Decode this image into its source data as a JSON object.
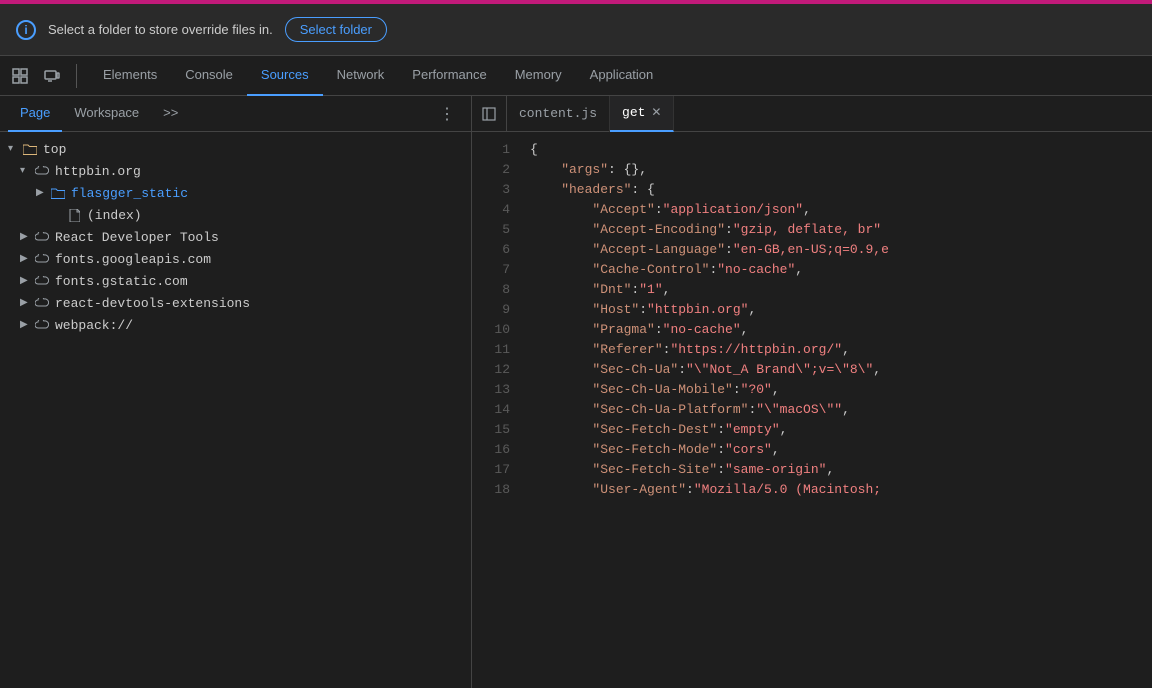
{
  "accent_bar": {
    "color": "#c21a7a"
  },
  "top_bar": {
    "info_text": "Select a folder to store override files in.",
    "select_folder_label": "Select folder"
  },
  "devtools_tabs": {
    "items": [
      {
        "label": "Elements",
        "active": false
      },
      {
        "label": "Console",
        "active": false
      },
      {
        "label": "Sources",
        "active": true
      },
      {
        "label": "Network",
        "active": false
      },
      {
        "label": "Performance",
        "active": false
      },
      {
        "label": "Memory",
        "active": false
      },
      {
        "label": "Application",
        "active": false
      }
    ]
  },
  "sub_tabs": {
    "items": [
      {
        "label": "Page",
        "active": true
      },
      {
        "label": "Workspace",
        "active": false
      },
      {
        "label": ">>",
        "active": false
      }
    ]
  },
  "file_tree": {
    "items": [
      {
        "label": "top",
        "type": "folder",
        "indent": 0,
        "expanded": true,
        "arrow": "▾"
      },
      {
        "label": "httpbin.org",
        "type": "cloud",
        "indent": 1,
        "expanded": true,
        "arrow": "▾"
      },
      {
        "label": "flasgger_static",
        "type": "folder",
        "indent": 2,
        "expanded": false,
        "arrow": "▶"
      },
      {
        "label": "(index)",
        "type": "file",
        "indent": 3,
        "expanded": false,
        "arrow": ""
      },
      {
        "label": "React Developer Tools",
        "type": "cloud",
        "indent": 1,
        "expanded": false,
        "arrow": "▶"
      },
      {
        "label": "fonts.googleapis.com",
        "type": "cloud",
        "indent": 1,
        "expanded": false,
        "arrow": "▶"
      },
      {
        "label": "fonts.gstatic.com",
        "type": "cloud",
        "indent": 1,
        "expanded": false,
        "arrow": "▶"
      },
      {
        "label": "react-devtools-extensions",
        "type": "cloud",
        "indent": 1,
        "expanded": false,
        "arrow": "▶"
      },
      {
        "label": "webpack://",
        "type": "cloud",
        "indent": 1,
        "expanded": false,
        "arrow": "▶"
      }
    ]
  },
  "editor_tabs": {
    "items": [
      {
        "label": "content.js",
        "active": false,
        "closeable": false
      },
      {
        "label": "get",
        "active": true,
        "closeable": true
      }
    ]
  },
  "code_lines": [
    {
      "num": 1,
      "content": "{"
    },
    {
      "num": 2,
      "content": "    \"args\": {},"
    },
    {
      "num": 3,
      "content": "    \"headers\": {"
    },
    {
      "num": 4,
      "content": "        \"Accept\": \"application/json\","
    },
    {
      "num": 5,
      "content": "        \"Accept-Encoding\": \"gzip, deflate, br\""
    },
    {
      "num": 6,
      "content": "        \"Accept-Language\": \"en-GB,en-US;q=0.9,e"
    },
    {
      "num": 7,
      "content": "        \"Cache-Control\": \"no-cache\","
    },
    {
      "num": 8,
      "content": "        \"Dnt\": \"1\","
    },
    {
      "num": 9,
      "content": "        \"Host\": \"httpbin.org\","
    },
    {
      "num": 10,
      "content": "        \"Pragma\": \"no-cache\","
    },
    {
      "num": 11,
      "content": "        \"Referer\": \"https://httpbin.org/\","
    },
    {
      "num": 12,
      "content": "        \"Sec-Ch-Ua\": \"\\\"Not_A Brand\\\";v=\\\"8\\\","
    },
    {
      "num": 13,
      "content": "        \"Sec-Ch-Ua-Mobile\": \"?0\","
    },
    {
      "num": 14,
      "content": "        \"Sec-Ch-Ua-Platform\": \"\\\"macOS\\\"\","
    },
    {
      "num": 15,
      "content": "        \"Sec-Fetch-Dest\": \"empty\","
    },
    {
      "num": 16,
      "content": "        \"Sec-Fetch-Mode\": \"cors\","
    },
    {
      "num": 17,
      "content": "        \"Sec-Fetch-Site\": \"same-origin\","
    },
    {
      "num": 18,
      "content": "        \"User-Agent\": \"Mozilla/5.0 (Macintosh;"
    }
  ]
}
